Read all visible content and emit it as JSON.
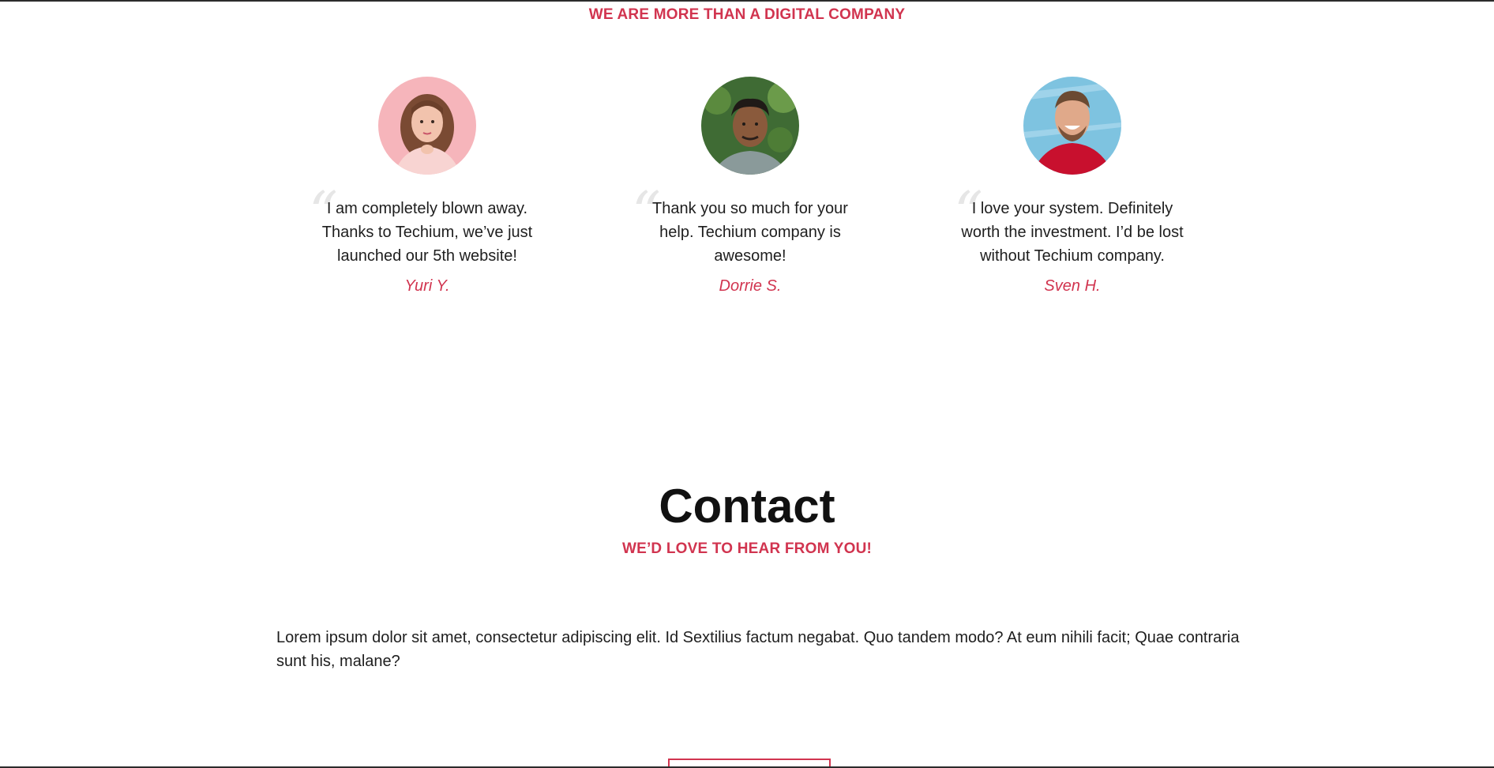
{
  "testimonials_section": {
    "tagline": "WE ARE MORE THAN A DIGITAL COMPANY",
    "items": [
      {
        "quote": "I am completely blown away. Thanks to Techium, we’ve just launched our 5th website!",
        "author": "Yuri Y."
      },
      {
        "quote": "Thank you so much for your help. Techium company is awesome!",
        "author": "Dorrie S."
      },
      {
        "quote": "I love your system. Definitely worth the investment. I’d be lost without Techium company.",
        "author": "Sven H."
      }
    ]
  },
  "contact_section": {
    "title": "Contact",
    "tagline": "WE’D LOVE TO HEAR FROM YOU!",
    "body": "Lorem ipsum dolor sit amet, consectetur adipiscing elit. Id Sextilius factum negabat. Quo tandem modo? At eum nihili facit; Quae contraria sunt his, malane?"
  },
  "colors": {
    "accent": "#d1344f",
    "text": "#1e1e1e",
    "heading": "#111111"
  }
}
